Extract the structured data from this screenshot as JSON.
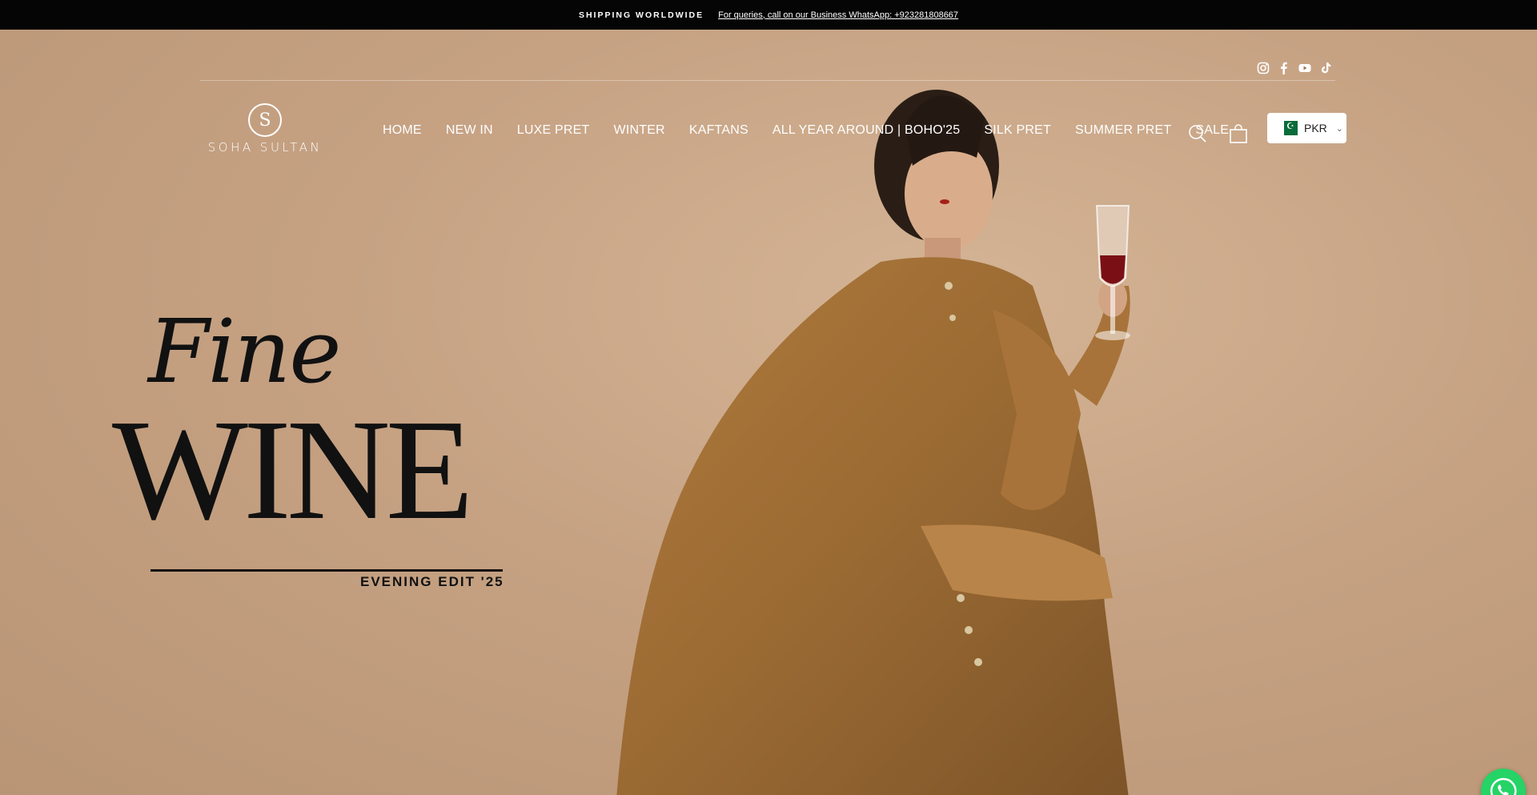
{
  "announcement": {
    "shipping": "SHIPPING WORLDWIDE",
    "query": "For queries, call on our Business WhatsApp: +923281808667"
  },
  "social": [
    "instagram-icon",
    "facebook-icon",
    "youtube-icon",
    "tiktok-icon"
  ],
  "logo": {
    "name": "SOHA SULTAN",
    "mark": "S"
  },
  "nav": {
    "items": [
      {
        "label": "HOME"
      },
      {
        "label": "NEW IN"
      },
      {
        "label": "LUXE PRET"
      },
      {
        "label": "WINTER"
      },
      {
        "label": "KAFTANS"
      },
      {
        "label": "ALL YEAR AROUND | BOHO'25"
      },
      {
        "label": "SILK PRET"
      },
      {
        "label": "SUMMER PRET"
      },
      {
        "label": "SALE"
      }
    ]
  },
  "currency": {
    "code": "PKR"
  },
  "hero": {
    "fine": "Fine",
    "wine": "WINE",
    "edit": "EVENING EDIT '25"
  },
  "colors": {
    "announcement_bg": "#050505",
    "hero_bg": "#c9a687",
    "whatsapp": "#25d366"
  }
}
